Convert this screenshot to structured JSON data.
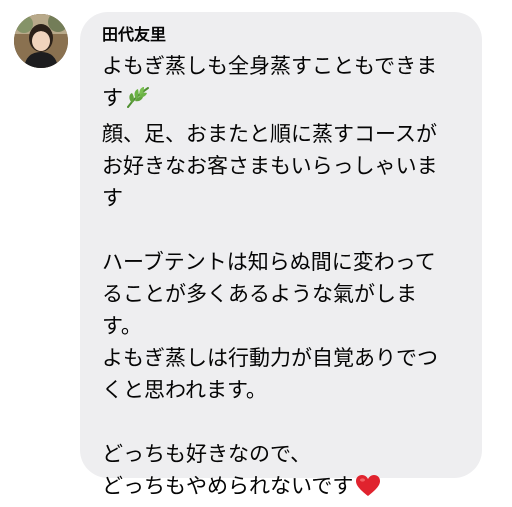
{
  "message": {
    "sender_name": "田代友里",
    "lines": [
      "よもぎ蒸しも全身蒸すこともできま",
      "す",
      "顔、足、おまたと順に蒸すコースが",
      "お好きなお客さまもいらっしゃいま",
      "す",
      "",
      "ハーブテントは知らぬ間に変わって",
      "ることが多くあるような氣がしま",
      "す。",
      "よもぎ蒸しは行動力が自覚ありでつ",
      "くと思われます。",
      "",
      "どっちも好きなので、",
      "どっちもやめられないです"
    ],
    "emoji": {
      "line_2": "herb-leaf-icon",
      "line_14": "red-heart-icon"
    }
  },
  "colors": {
    "bubble_background": "#eeeef0",
    "text": "#050505",
    "heart": "#e0232e",
    "leaf": "#5fa33c"
  }
}
